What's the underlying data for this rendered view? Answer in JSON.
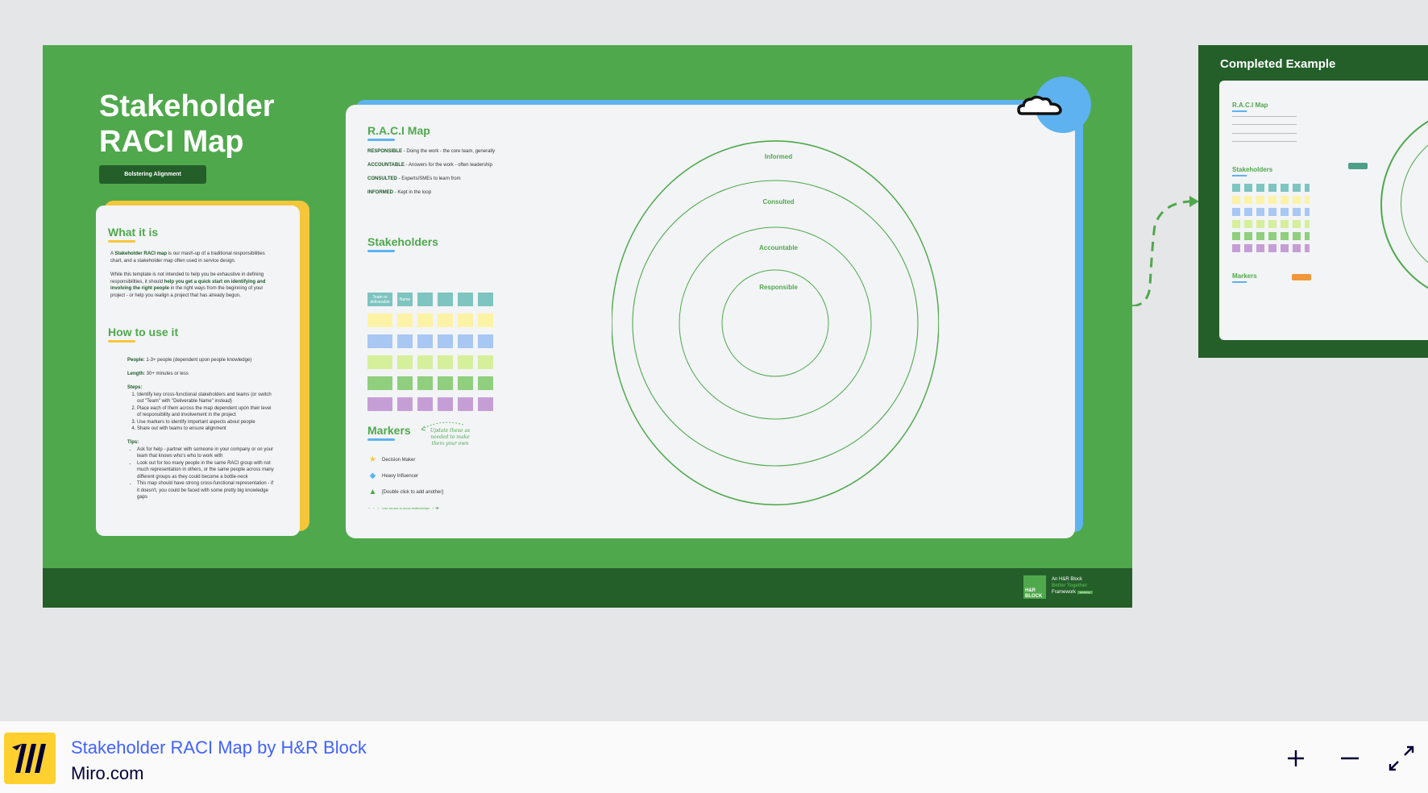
{
  "board": {
    "title": "Stakeholder RACI Map",
    "pill": "Bolstering Alignment",
    "colors": {
      "green": "#50a84c",
      "dark_green": "#245f2a",
      "blue": "#5db2ef",
      "yellow": "#f5c63c"
    }
  },
  "left_card": {
    "what_heading": "What it is",
    "what_p1_pre": "A ",
    "what_p1_bold": "Stakeholder RACI map",
    "what_p1_post": " is our mash-up of a traditional responsibilities chart, and a stakeholder map often used in service design.",
    "what_p2_pre": "While this template is not intended to help you be exhaustive in defining responsibilities, it should ",
    "what_p2_bold": "help you get a quick start on identifying and involving the right people",
    "what_p2_post": " in the right ways from the beginning of your project - or help you realign a project that has already begun.",
    "how_heading": "How to use it",
    "people_label": "People:",
    "people_value": " 1-3+ people (dependent upon people knowledge)",
    "length_label": "Length:",
    "length_value": " 30+ minutes or less",
    "steps_label": "Steps:",
    "steps": [
      "Identify key cross-functional stakeholders and teams (or switch out \"Team\" with \"Deliverable Name\" instead)",
      "Place each of them across the map dependent upon their level of responsibility and involvement in the project",
      "Use markers to identify important aspects about people",
      "Share out with teams to ensure alignment"
    ],
    "tips_label": "Tips:",
    "tips": [
      "Ask for help - partner with someone in your company or on your team that knows who's who to work with",
      "Look out for too many people in the same RACI group with not much representation in others, or the same people across many different groups as they could become a bottle-neck",
      "This map should have strong cross-functional representation - if it doesn't, you could be faced with some pretty big knowledge gaps"
    ]
  },
  "raci": {
    "heading": "R.A.C.I Map",
    "definitions": [
      {
        "term": "RESPONSIBLE",
        "desc": " - Doing the work - the core team, generally"
      },
      {
        "term": "ACCOUNTABLE",
        "desc": " - Answers for the work - often leadership"
      },
      {
        "term": "CONSULTED",
        "desc": " - Experts/SMEs to learn from"
      },
      {
        "term": "INFORMED",
        "desc": " - Kept in the loop"
      }
    ],
    "rings": [
      "Informed",
      "Consulted",
      "Accountable",
      "Responsible"
    ]
  },
  "stakeholders": {
    "heading": "Stakeholders",
    "team_label": "Team or deliverable",
    "name_label": "Name",
    "row_colors": [
      "#7ec4c0",
      "#fdf3a6",
      "#a8c7f2",
      "#d5ef9b",
      "#8fcf7d",
      "#c69ed6"
    ]
  },
  "markers": {
    "heading": "Markers",
    "note": "Update these as needed to make them your own",
    "items": [
      {
        "icon": "star-icon",
        "label": "Decision Maker"
      },
      {
        "icon": "diamond-icon",
        "label": "Heavy Influencer"
      },
      {
        "icon": "triangle-icon",
        "label": "[Double click to add another]"
      }
    ],
    "connector_label": "Use arrows to show relationships"
  },
  "footer": {
    "line1": "An H&R Block",
    "line2": "Better Together",
    "line3": "Framework",
    "badge": "Workshop",
    "logo": "H&R BLOCK"
  },
  "example": {
    "title": "Completed Example",
    "raci_heading": "R.A.C.I Map",
    "stakeholders_heading": "Stakeholders",
    "markers_heading": "Markers"
  },
  "bottom": {
    "title": "Stakeholder RACI Map by H&R Block",
    "subtitle": "Miro.com",
    "zoom_in": "+",
    "zoom_out": "−"
  }
}
